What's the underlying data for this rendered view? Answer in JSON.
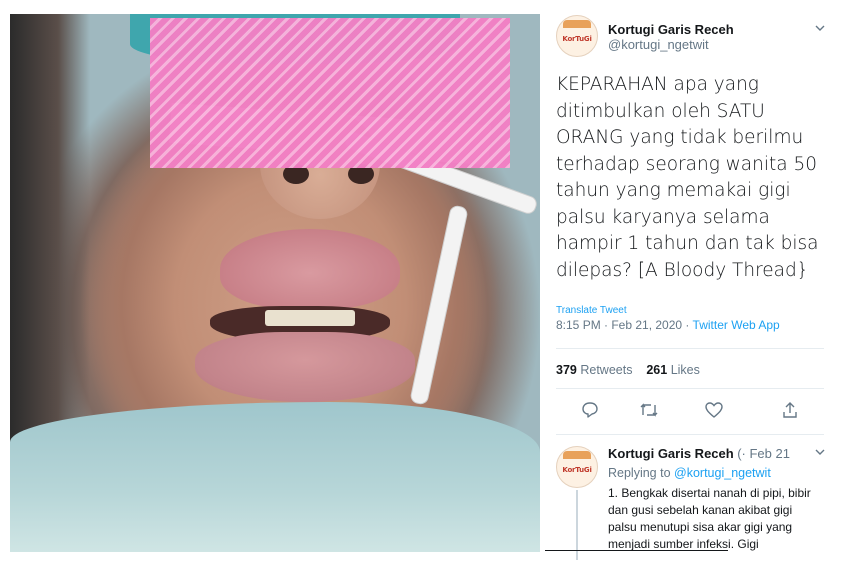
{
  "tweet": {
    "display_name": "Kortugi Garis Receh",
    "handle": "@kortugi_ngetwit",
    "avatar_text": "KorTuGi",
    "text": "KEPARAHAN apa yang ditimbulkan oleh SATU ORANG yang tidak berilmu terhadap seorang wanita 50 tahun yang memakai gigi palsu karyanya selama hampir 1 tahun dan tak bisa dilepas? [A Bloody Thread}",
    "translate_label": "Translate Tweet",
    "timestamp": "8:15 PM · Feb 21, 2020 · ",
    "via": "Twitter Web App",
    "retweets_count": "379",
    "retweets_label": "Retweets",
    "likes_count": "261",
    "likes_label": "Likes"
  },
  "reply": {
    "display_name": "Kortugi Garis Receh",
    "meta": "(· Feb 21",
    "replying_to_label": "Replying to",
    "replying_to_handle": "@kortugi_ngetwit",
    "text": "1. Bengkak disertai nanah di pipi, bibir dan gusi sebelah kanan akibat gigi palsu menutupi sisa akar gigi yang menjadi sumber infeksi. Gigi"
  },
  "icons": {
    "reply": "reply-icon",
    "retweet": "retweet-icon",
    "like": "heart-icon",
    "share": "share-icon",
    "more": "chevron-down-icon"
  },
  "colors": {
    "link": "#1da1f2",
    "muted": "#657786",
    "text": "#14171a",
    "censor": "#f27fc4"
  }
}
